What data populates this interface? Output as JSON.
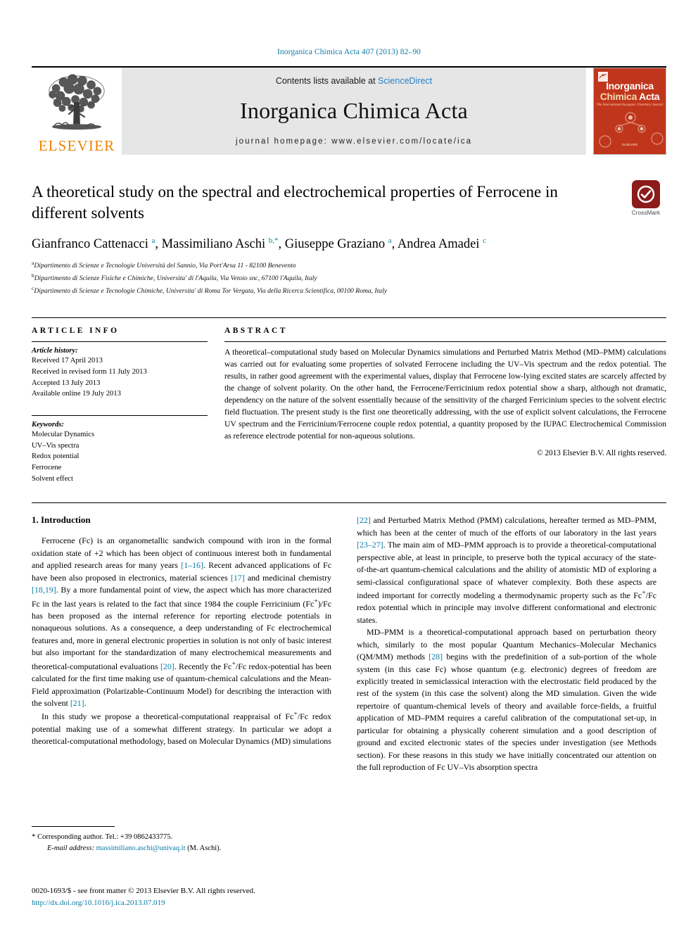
{
  "running_head": "Inorganica Chimica Acta 407 (2013) 82–90",
  "masthead": {
    "publisher_name": "ELSEVIER",
    "contents_prefix": "Contents lists available at ",
    "contents_link": "ScienceDirect",
    "journal_title": "Inorganica Chimica Acta",
    "homepage": "journal homepage: www.elsevier.com/locate/ica",
    "cover": {
      "line1": "Inorganica",
      "line2_a": "Chimica",
      "line2_b": "Acta",
      "subtitle": "The International Inorganic Chemistry Journal",
      "footer": "ELSEVIER"
    }
  },
  "article": {
    "title": "A theoretical study on the spectral and electrochemical properties of Ferrocene in different solvents",
    "crossmark_label": "CrossMark",
    "authors_html": "Gianfranco Cattenacci <sup>a</sup>, Massimiliano Aschi <sup>b,*</sup>, Giuseppe Graziano <sup>a</sup>, Andrea Amadei <sup>c</sup>",
    "affiliations": [
      {
        "marker": "a",
        "text": "Dipartimento di Scienze e Tecnologie Università del Sannio, Via Port'Arsa 11 - 82100 Benevento"
      },
      {
        "marker": "b",
        "text": "Dipartimento di Scienze Fisiche e Chimiche, Universita' di l'Aquila, Via Vetoio snc, 67100 l'Aquila, Italy"
      },
      {
        "marker": "c",
        "text": "Dipartimento di Scienze e Tecnologie Chimiche, Universita' di Roma Tor Vergata, Via della Ricerca Scientifica, 00100 Roma, Italy"
      }
    ]
  },
  "article_info": {
    "heading": "ARTICLE INFO",
    "history_label": "Article history:",
    "history": [
      "Received 17 April 2013",
      "Received in revised form 11 July 2013",
      "Accepted 13 July 2013",
      "Available online 19 July 2013"
    ],
    "keywords_label": "Keywords:",
    "keywords": [
      "Molecular Dynamics",
      "UV–Vis spectra",
      "Redox potential",
      "Ferrocene",
      "Solvent effect"
    ]
  },
  "abstract": {
    "heading": "ABSTRACT",
    "text": "A theoretical–computational study based on Molecular Dynamics simulations and Perturbed Matrix Method (MD–PMM) calculations was carried out for evaluating some properties of solvated Ferrocene including the UV–Vis spectrum and the redox potential. The results, in rather good agreement with the experimental values, display that Ferrocene low-lying excited states are scarcely affected by the change of solvent polarity. On the other hand, the Ferrocene/Ferricinium redox potential show a sharp, although not dramatic, dependency on the nature of the solvent essentially because of the sensitivity of the charged Ferricinium species to the solvent electric field fluctuation. The present study is the first one theoretically addressing, with the use of explicit solvent calculations, the Ferrocene UV spectrum and the Ferricinium/Ferrocene couple redox potential, a quantity proposed by the IUPAC Electrochemical Commission as reference electrode potential for non-aqueous solutions.",
    "copyright": "© 2013 Elsevier B.V. All rights reserved."
  },
  "body": {
    "section_heading": "1. Introduction",
    "left_paragraphs": [
      "Ferrocene (Fc) is an organometallic sandwich compound with iron in the formal oxidation state of +2 which has been object of continuous interest both in fundamental and applied research areas for many years <span class=\"cite\">[1–16]</span>. Recent advanced applications of Fc have been also proposed in electronics, material sciences <span class=\"cite\">[17]</span> and medicinal chemistry <span class=\"cite\">[18,19]</span>. By a more fundamental point of view, the aspect which has more characterized Fc in the last years is related to the fact that since 1984 the couple Ferricinium (Fc<sup>+</sup>)/Fc has been proposed as the internal reference for reporting electrode potentials in nonaqueous solutions. As a consequence, a deep understanding of Fc electrochemical features and, more in general electronic properties in solution is not only of basic interest but also important for the standardization of many electrochemical measurements and theoretical-computational evaluations <span class=\"cite\">[20]</span>. Recently the Fc<sup>+</sup>/Fc redox-potential has been calculated for the first time making use of quantum-chemical calculations and the Mean-Field approximation (Polarizable-Continuum Model) for describing the interaction with the solvent <span class=\"cite\">[21]</span>.",
      "In this study we propose a theoretical-computational reappraisal of Fc<sup>+</sup>/Fc redox potential making use of a somewhat different strategy. In particular we adopt a theoretical-computational methodology, based on Molecular Dynamics (MD) simulations"
    ],
    "right_paragraphs": [
      "<span class=\"cite\">[22]</span> and Perturbed Matrix Method (PMM) calculations, hereafter termed as MD–PMM, which has been at the center of much of the efforts of our laboratory in the last years <span class=\"cite\">[23–27]</span>. The main aim of MD–PMM approach is to provide a theoretical-computational perspective able, at least in principle, to preserve both the typical accuracy of the state-of-the-art quantum-chemical calculations and the ability of atomistic MD of exploring a semi-classical configurational space of whatever complexity. Both these aspects are indeed important for correctly modeling a thermodynamic property such as the Fc<sup>+</sup>/Fc redox potential which in principle may involve different conformational and electronic states.",
      "MD–PMM is a theoretical-computational approach based on perturbation theory which, similarly to the most popular Quantum Mechanics–Molecular Mechanics (QM/MM) methods <span class=\"cite\">[28]</span> begins with the predefinition of a sub-portion of the whole system (in this case Fc) whose quantum (e.g. electronic) degrees of freedom are explicitly treated in semiclassical interaction with the electrostatic field produced by the rest of the system (in this case the solvent) along the MD simulation. Given the wide repertoire of quantum-chemical levels of theory and available force-fields, a fruitful application of MD–PMM requires a careful calibration of the computational set-up, in particular for obtaining a physically coherent simulation and a good description of ground and excited electronic states of the species under investigation (see Methods section). For these reasons in this study we have initially concentrated our attention on the full reproduction of Fc UV–Vis absorption spectra"
    ]
  },
  "footnote": {
    "star": "*",
    "corresponding": "Corresponding author. Tel.: +39 0862433775.",
    "email_label": "E-mail address:",
    "email": "massimiliano.aschi@univaq.it",
    "email_suffix": "(M. Aschi)."
  },
  "page_footer": {
    "issn_line": "0020-1693/$ - see front matter © 2013 Elsevier B.V. All rights reserved.",
    "doi": "http://dx.doi.org/10.1016/j.ica.2013.07.019"
  },
  "colors": {
    "link_blue": "#0b7ba8",
    "sciencedirect_blue": "#2a7fc1",
    "elsevier_orange": "#ef8200",
    "cover_red": "#c0361c",
    "crossmark_red": "#8c1b1b",
    "banner_grey": "#e6e6e6"
  }
}
